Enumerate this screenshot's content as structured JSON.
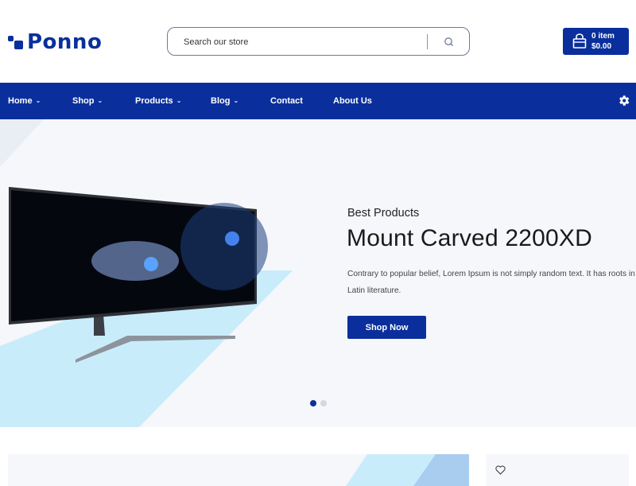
{
  "header": {
    "logo_text": "Ponno",
    "search": {
      "placeholder": "Search our store",
      "value": ""
    },
    "cart": {
      "count_label": "0 item",
      "total_label": "$0.00"
    }
  },
  "nav": {
    "items": [
      {
        "label": "Home",
        "has_dropdown": true
      },
      {
        "label": "Shop",
        "has_dropdown": true
      },
      {
        "label": "Products",
        "has_dropdown": true
      },
      {
        "label": "Blog",
        "has_dropdown": true
      },
      {
        "label": "Contact",
        "has_dropdown": false
      },
      {
        "label": "About Us",
        "has_dropdown": false
      }
    ],
    "chevron": "⌄",
    "settings_icon": "gear-icon"
  },
  "hero": {
    "subtitle": "Best Products",
    "title": "Mount Carved 2200XD",
    "description_line1": "Contrary to popular belief, Lorem Ipsum is not simply random text. It has roots in a",
    "description_line2": "Latin literature.",
    "button_label": "Shop Now",
    "slides": {
      "total": 2,
      "active_index": 0
    },
    "image_alt": "curved-monitor"
  },
  "colors": {
    "brand": "#0a2f9c",
    "hero_bg": "#f5f7fa",
    "accent_light": "#c9ecfb",
    "accent_mid": "#a9cdef"
  }
}
